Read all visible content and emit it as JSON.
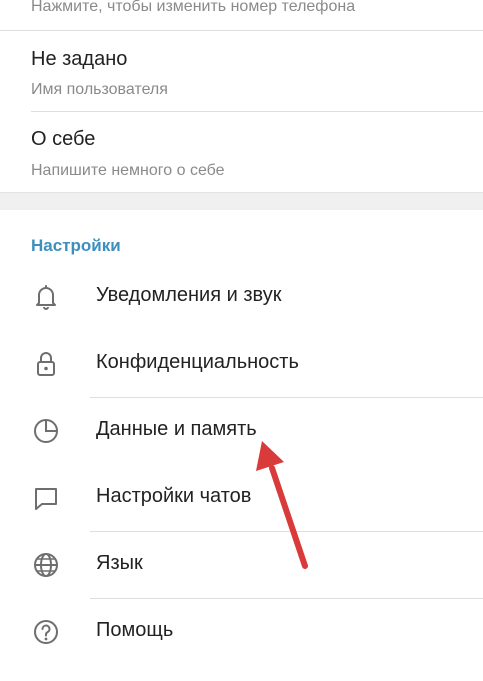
{
  "profile": {
    "phone_hint": "Нажмите, чтобы изменить номер телефона",
    "username_value": "Не задано",
    "username_label": "Имя пользователя",
    "bio_value": "О себе",
    "bio_hint": "Напишите немного о себе"
  },
  "settings": {
    "title": "Настройки",
    "items": [
      {
        "label": "Уведомления и звук",
        "icon": "bell-icon"
      },
      {
        "label": "Конфиденциальность",
        "icon": "lock-icon"
      },
      {
        "label": "Данные и память",
        "icon": "pie-chart-icon"
      },
      {
        "label": "Настройки чатов",
        "icon": "chat-bubble-icon"
      },
      {
        "label": "Язык",
        "icon": "globe-icon"
      },
      {
        "label": "Помощь",
        "icon": "help-icon"
      }
    ]
  },
  "colors": {
    "accent": "#3d8fbf",
    "arrow": "#d93a3a",
    "divider": "#dedede",
    "secondary_text": "#8a8a8a"
  }
}
